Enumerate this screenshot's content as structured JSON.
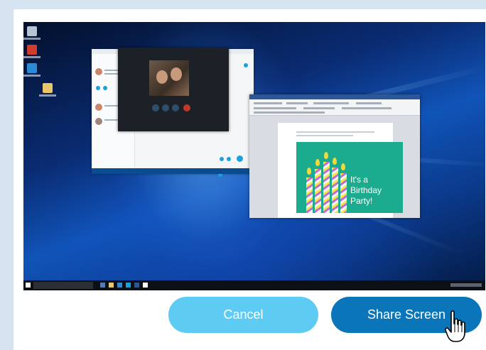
{
  "dialog": {
    "cancel_label": "Cancel",
    "share_label": "Share Screen"
  },
  "preview": {
    "card_text": [
      "It's a",
      "Birthday",
      "Party!"
    ]
  },
  "colors": {
    "cancel_button": "#5ecbf3",
    "share_button": "#0a75b8",
    "page_background": "#d6e4f2",
    "card_background": "#1bab8e"
  },
  "icons": [
    "hand-pointer-cursor-icon",
    "windows-start-icon"
  ]
}
